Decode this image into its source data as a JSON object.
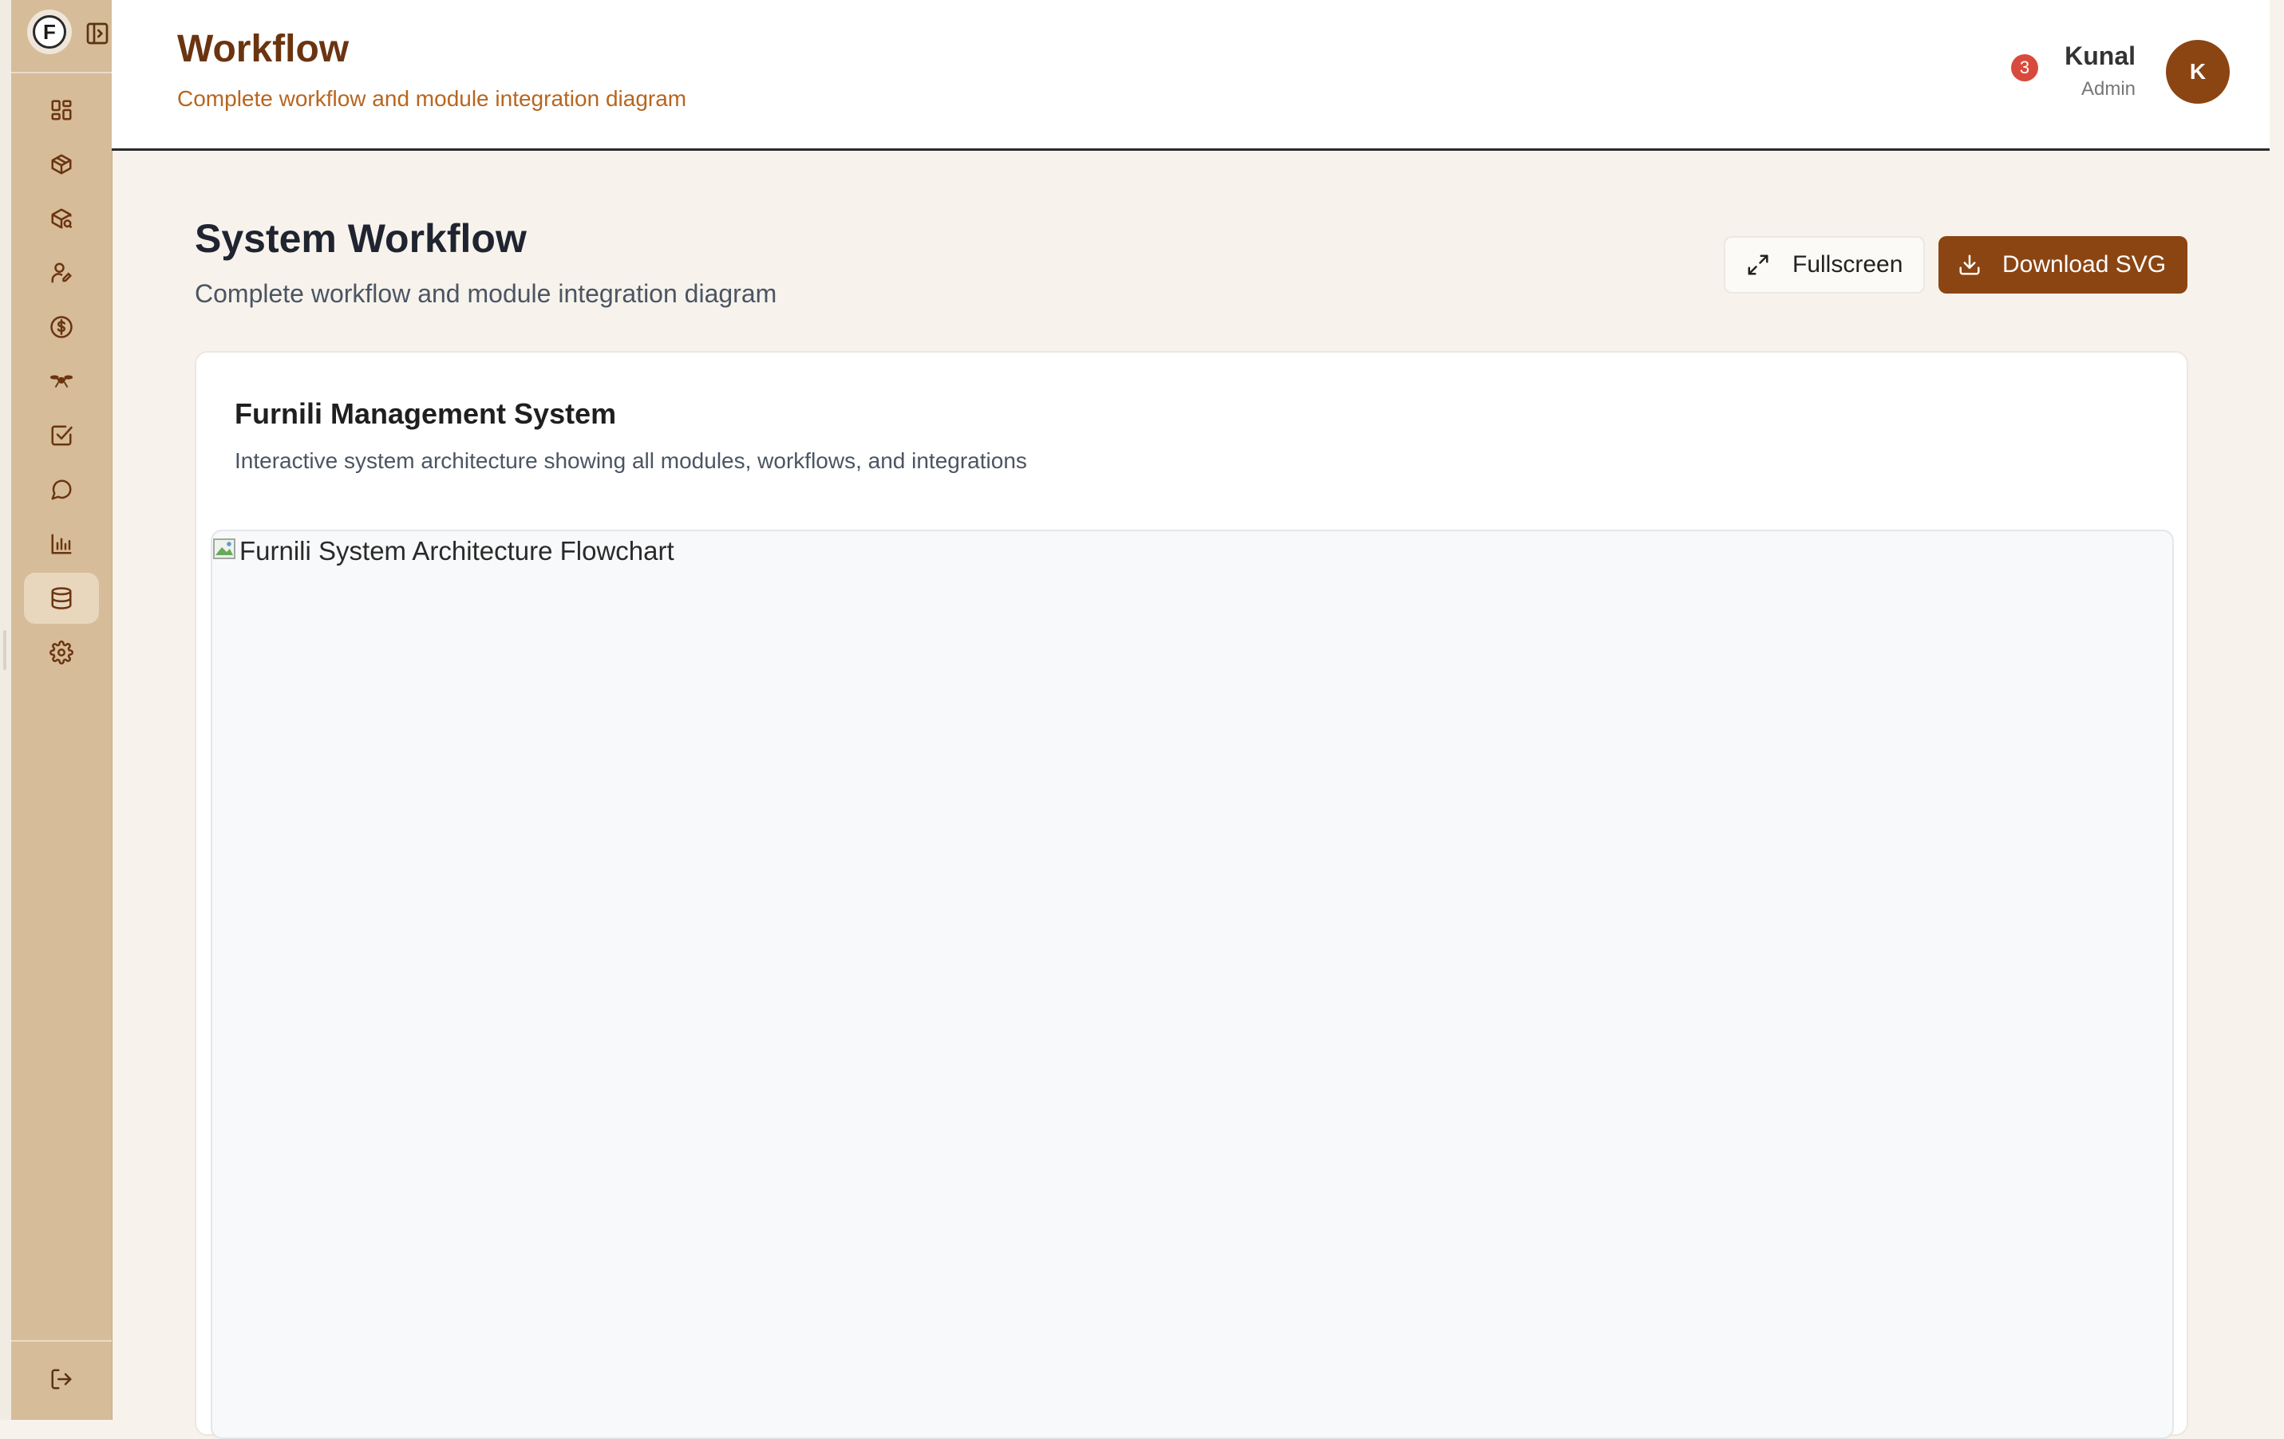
{
  "header": {
    "title": "Workflow",
    "subtitle": "Complete workflow and module integration diagram",
    "notification_count": "3",
    "user": {
      "name": "Kunal",
      "role": "Admin",
      "initial": "K"
    }
  },
  "sidebar": {
    "logo_letter": "F",
    "items": [
      {
        "icon": "dashboard-icon"
      },
      {
        "icon": "box-icon"
      },
      {
        "icon": "package-search-icon"
      },
      {
        "icon": "user-edit-icon"
      },
      {
        "icon": "dollar-icon"
      },
      {
        "icon": "drone-icon"
      },
      {
        "icon": "checkbox-icon"
      },
      {
        "icon": "chat-icon"
      },
      {
        "icon": "bar-chart-icon"
      },
      {
        "icon": "database-icon",
        "active": true
      },
      {
        "icon": "settings-icon"
      }
    ],
    "logout_icon": "logout-icon"
  },
  "main": {
    "title": "System Workflow",
    "subtitle": "Complete workflow and module integration diagram",
    "fullscreen_label": "Fullscreen",
    "download_label": "Download SVG",
    "card": {
      "title": "Furnili Management System",
      "subtitle": "Interactive system architecture showing all modules, workflows, and integrations",
      "image_alt": "Furnili System Architecture Flowchart"
    }
  },
  "colors": {
    "brand": "#8b4513",
    "sidebar": "#d6bc99",
    "background": "#f7f3ec",
    "badge": "#d84b3c"
  }
}
